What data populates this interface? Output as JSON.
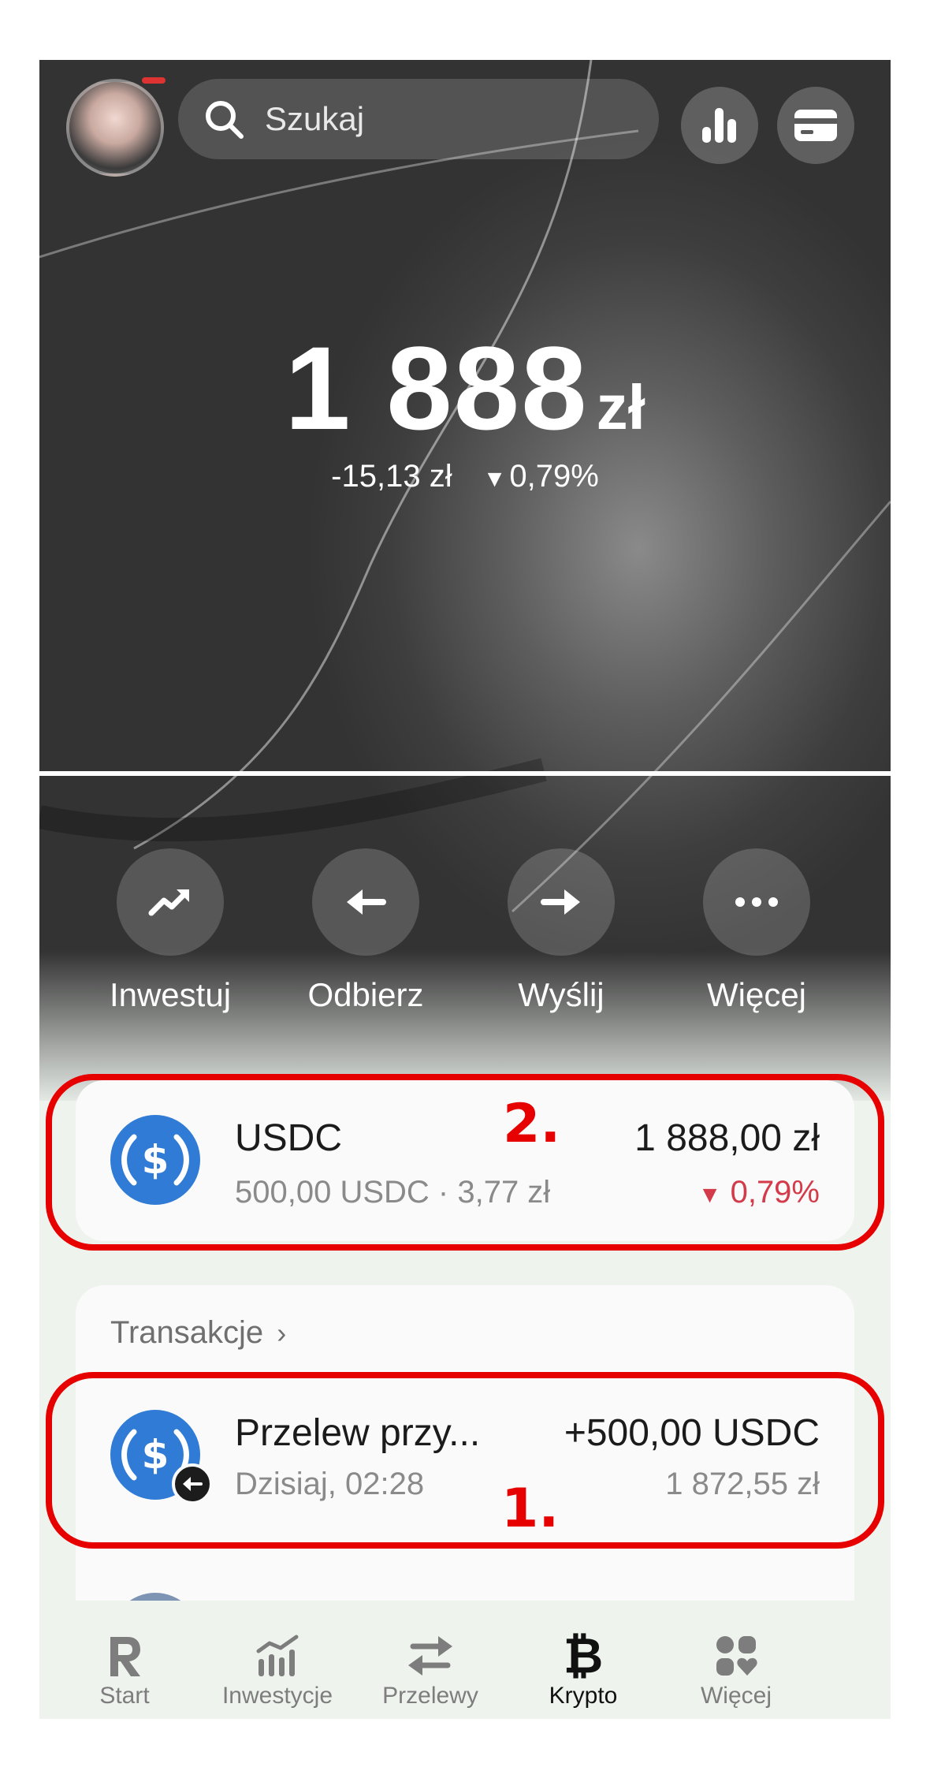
{
  "search": {
    "placeholder": "Szukaj"
  },
  "balance": {
    "amount": "1 888",
    "currency": "zł",
    "change_value": "-15,13 zł",
    "change_pct": "0,79%",
    "change_direction": "down"
  },
  "actions": [
    {
      "label": "Inwestuj",
      "icon": "trend-up-icon"
    },
    {
      "label": "Odbierz",
      "icon": "arrow-left-icon"
    },
    {
      "label": "Wyślij",
      "icon": "arrow-right-icon"
    },
    {
      "label": "Więcej",
      "icon": "more-dots-icon"
    }
  ],
  "asset": {
    "name": "USDC",
    "detail": "500,00 USDC · 3,77 zł",
    "value": "1 888,00 zł",
    "change_pct": "0,79%",
    "change_color": "#d33a4a"
  },
  "transactions": {
    "header": "Transakcje",
    "items": [
      {
        "title": "Przelew przy...",
        "time": "Dzisiaj, 02:28",
        "amount": "+500,00 USDC",
        "fiat": "1 872,55 zł"
      }
    ]
  },
  "annotations": {
    "first": "1.",
    "second": "2.",
    "color": "#e60000"
  },
  "tabbar": [
    {
      "label": "Start",
      "icon": "revolut-r-icon",
      "active": false
    },
    {
      "label": "Inwestycje",
      "icon": "chart-line-icon",
      "active": false
    },
    {
      "label": "Przelewy",
      "icon": "transfer-arrows-icon",
      "active": false
    },
    {
      "label": "Krypto",
      "icon": "bitcoin-icon",
      "active": true
    },
    {
      "label": "Więcej",
      "icon": "grid-heart-icon",
      "active": false
    }
  ],
  "colors": {
    "usdc_blue": "#2f7bd6",
    "negative": "#d33a4a"
  }
}
